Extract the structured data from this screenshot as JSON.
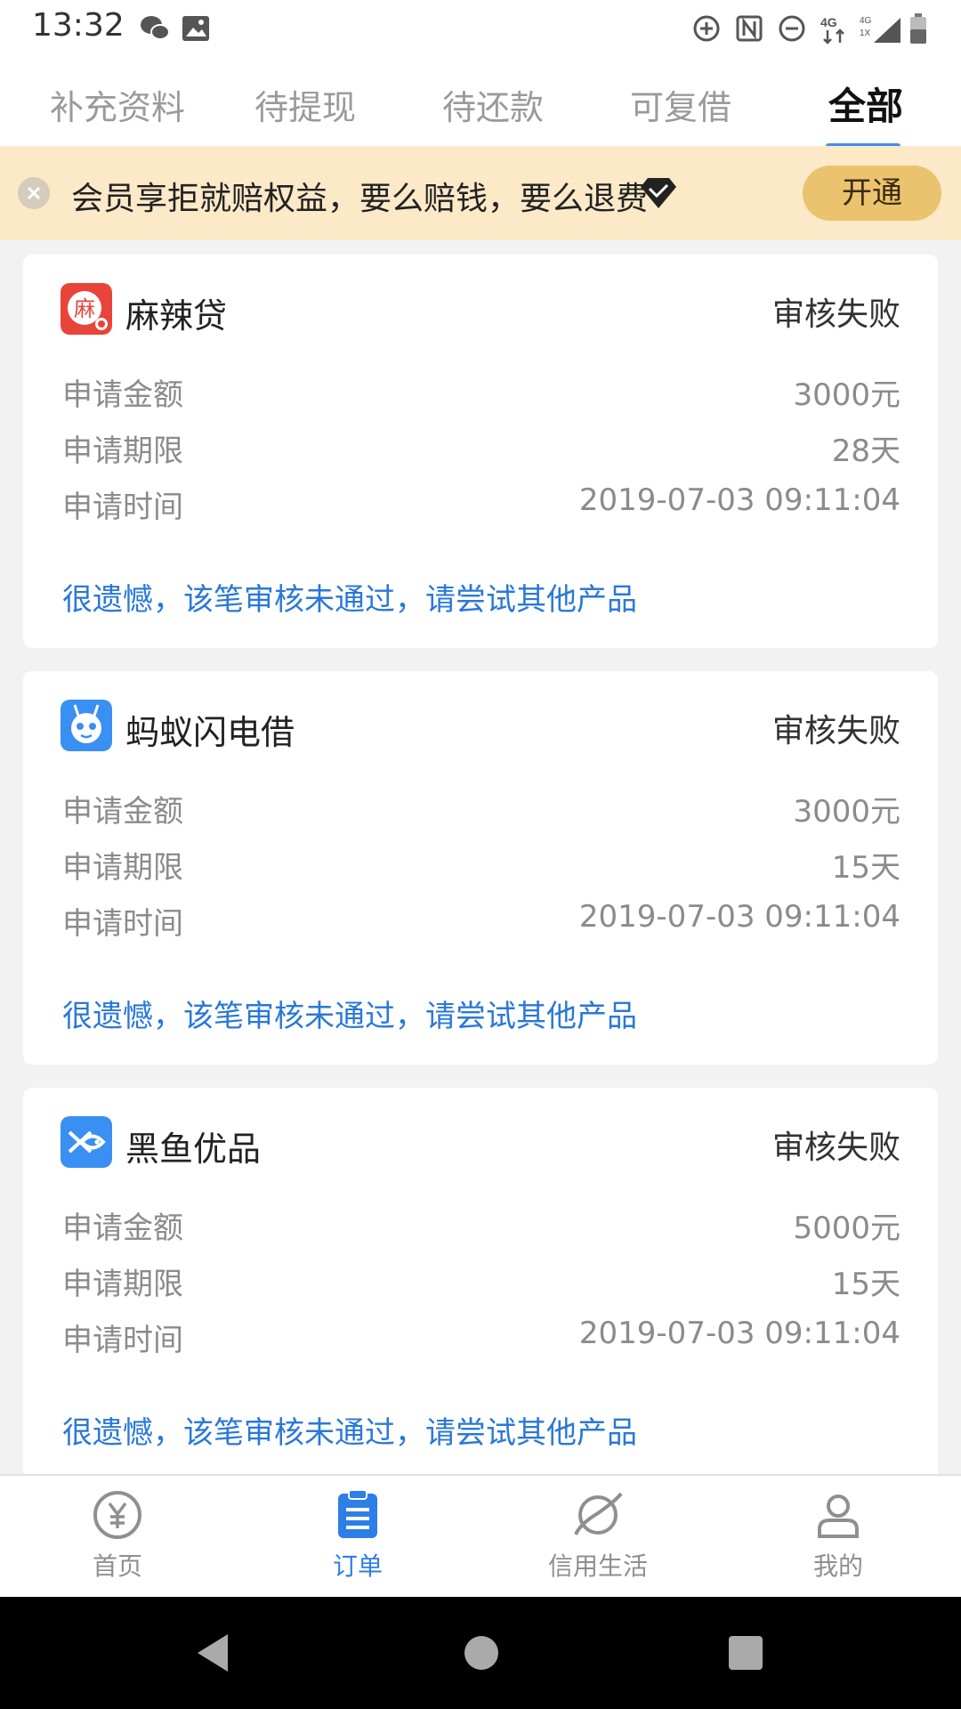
{
  "status_bar": {
    "time": "13:32"
  },
  "tabs": [
    {
      "label": "补充资料"
    },
    {
      "label": "待提现"
    },
    {
      "label": "待还款"
    },
    {
      "label": "可复借"
    },
    {
      "label": "全部"
    }
  ],
  "promo": {
    "text": "会员享拒就赔权益，要么赔钱，要么退费",
    "button": "开通"
  },
  "cards": [
    {
      "brand": "麻辣贷",
      "logo_char": "麻",
      "status": "审核失败",
      "rows": [
        {
          "label": "申请金额",
          "value": "3000元"
        },
        {
          "label": "申请期限",
          "value": "28天"
        },
        {
          "label": "申请时间",
          "value": "2019-07-03 09:11:04"
        }
      ],
      "notice": "很遗憾，该笔审核未通过，请尝试其他产品"
    },
    {
      "brand": "蚂蚁闪电借",
      "status": "审核失败",
      "rows": [
        {
          "label": "申请金额",
          "value": "3000元"
        },
        {
          "label": "申请期限",
          "value": "15天"
        },
        {
          "label": "申请时间",
          "value": "2019-07-03 09:11:04"
        }
      ],
      "notice": "很遗憾，该笔审核未通过，请尝试其他产品"
    },
    {
      "brand": "黑鱼优品",
      "status": "审核失败",
      "rows": [
        {
          "label": "申请金额",
          "value": "5000元"
        },
        {
          "label": "申请期限",
          "value": "15天"
        },
        {
          "label": "申请时间",
          "value": "2019-07-03 09:11:04"
        }
      ],
      "notice": "很遗憾，该笔审核未通过，请尝试其他产品"
    }
  ],
  "bottom_nav": [
    {
      "label": "首页",
      "icon": "yen-circle-icon"
    },
    {
      "label": "订单",
      "icon": "order-list-icon"
    },
    {
      "label": "信用生活",
      "icon": "planet-icon"
    },
    {
      "label": "我的",
      "icon": "person-icon"
    }
  ],
  "colors": {
    "accent": "#3d8ff0",
    "link": "#2a78d8",
    "promo_bg": "#fbe9c8",
    "promo_button": "#ebc36e"
  }
}
